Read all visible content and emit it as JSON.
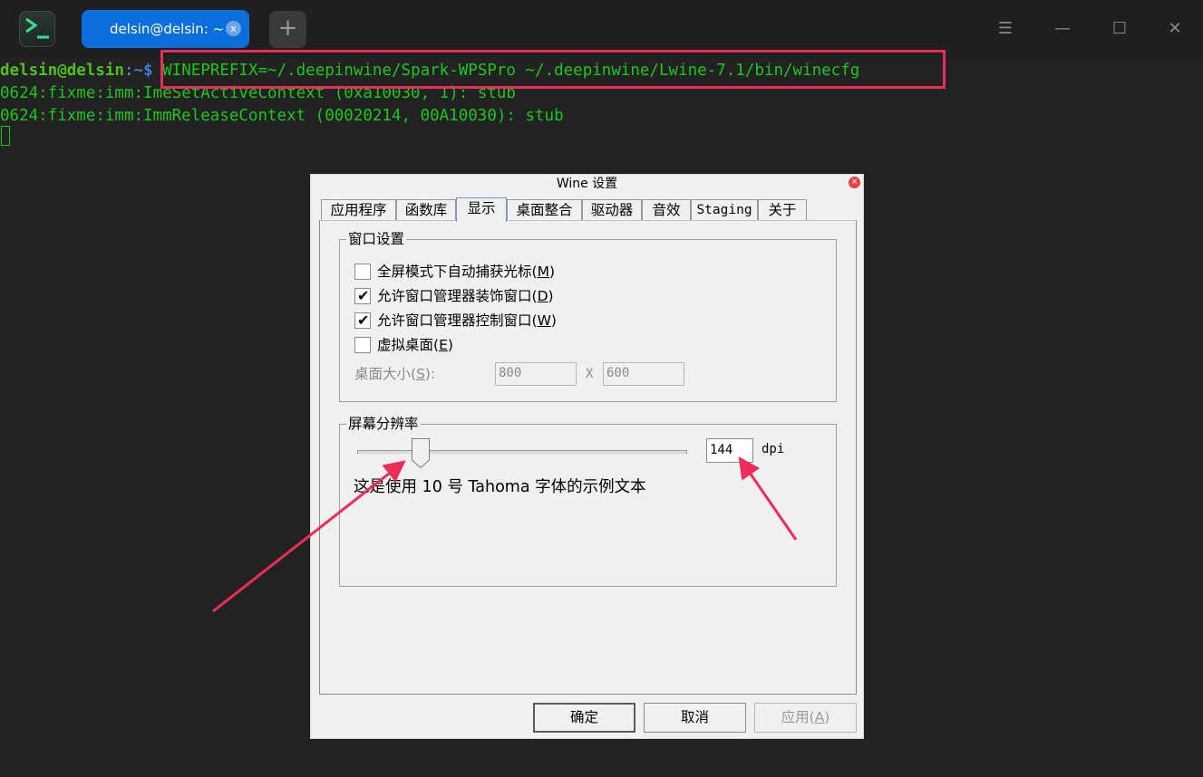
{
  "terminal": {
    "tab_title": "delsin@delsin: ~",
    "tab_close": "x",
    "new_tab": "+",
    "window_controls": {
      "menu": "☰",
      "minimize": "—",
      "maximize": "☐",
      "close": "✕"
    },
    "prompt_user": "delsin@delsin",
    "prompt_sep": ":",
    "prompt_path": "~",
    "prompt_symbol": "$ ",
    "command": "WINEPREFIX=~/.deepinwine/Spark-WPSPro ~/.deepinwine/Lwine-7.1/bin/winecfg",
    "output": [
      "0624:fixme:imm:ImeSetActiveContext (0xa10030, 1): stub",
      "0624:fixme:imm:ImmReleaseContext (00020214, 00A10030): stub"
    ],
    "highlight_color": "#ea2e57"
  },
  "dialog": {
    "title": "Wine 设置",
    "close": "×",
    "tabs": [
      "应用程序",
      "函数库",
      "显示",
      "桌面整合",
      "驱动器",
      "音效",
      "Staging",
      "关于"
    ],
    "active_tab": "显示",
    "window_group": {
      "title": "窗口设置",
      "checkboxes": [
        {
          "label": "全屏模式下自动捕获光标(",
          "key": "M",
          "tail": ")",
          "checked": false
        },
        {
          "label": "允许窗口管理器装饰窗口(",
          "key": "D",
          "tail": ")",
          "checked": true
        },
        {
          "label": "允许窗口管理器控制窗口(",
          "key": "W",
          "tail": ")",
          "checked": true
        },
        {
          "label": "虚拟桌面(",
          "key": "E",
          "tail": ")",
          "checked": false
        }
      ],
      "checkmark": "✔",
      "desktop_size_label": "桌面大小(",
      "desktop_size_key": "S",
      "desktop_size_tail": "):",
      "width": "800",
      "x_sep": "X",
      "height": "600"
    },
    "resolution_group": {
      "title": "屏幕分辨率",
      "dpi_value": "144",
      "dpi_unit": "dpi",
      "slider_fraction": 0.19,
      "sample_text": "这是使用 10 号 Tahoma 字体的示例文本"
    },
    "buttons": {
      "ok": "确定",
      "cancel": "取消",
      "apply": "应用(",
      "apply_key": "A",
      "apply_tail": ")"
    }
  },
  "annotation_color": "#ea2e57"
}
